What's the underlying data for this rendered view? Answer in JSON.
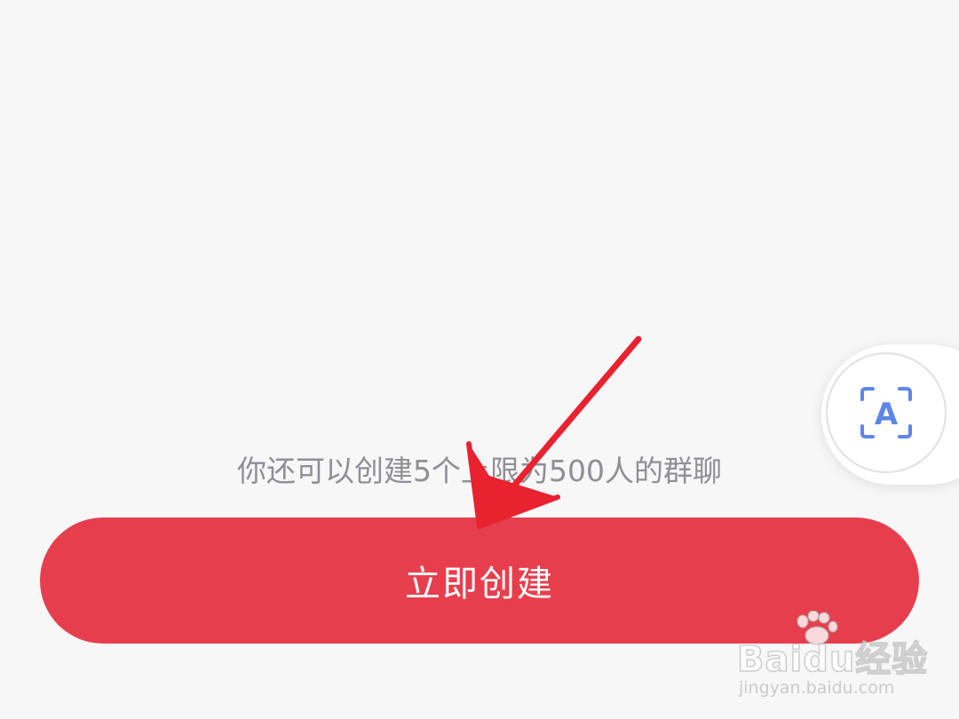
{
  "info_text": "你还可以创建5个上限为500人的群聊",
  "create_button": {
    "label": "立即创建"
  },
  "floating_button": {
    "icon": "text-recognition-icon",
    "glyph": "A"
  },
  "annotation": {
    "type": "arrow",
    "color": "#e8222f"
  },
  "watermark": {
    "logo": "Baidu经验",
    "url": "jingyan.baidu.com"
  },
  "colors": {
    "background": "#f7f7f8",
    "button": "#e73e4d",
    "button_text": "#ffffff",
    "info_text": "#8f8f94",
    "icon_blue": "#5f86e6"
  }
}
